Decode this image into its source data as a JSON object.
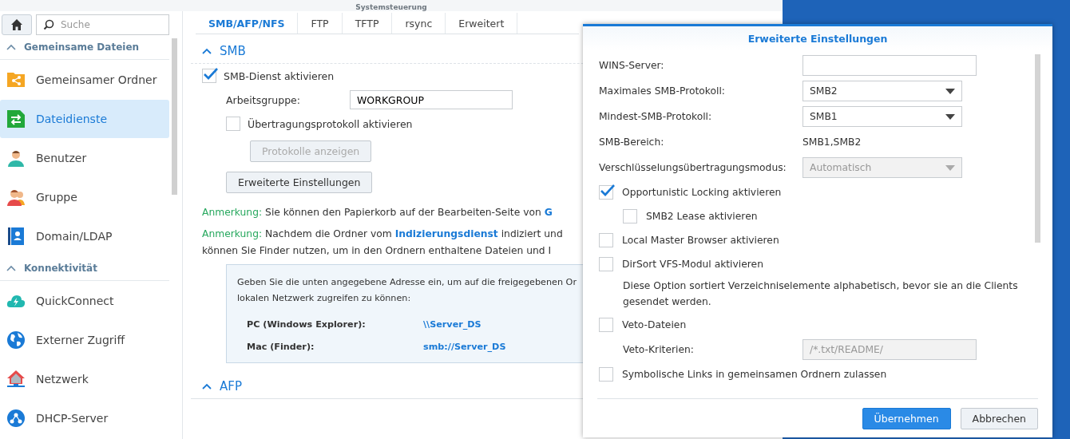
{
  "window": {
    "title": "Systemsteuerung"
  },
  "sidebar": {
    "search": {
      "placeholder": "Suche"
    },
    "sections": [
      {
        "title": "Gemeinsame Dateien",
        "expanded": true,
        "items": [
          {
            "label": "Gemeinsamer Ordner",
            "selected": false
          },
          {
            "label": "Dateidienste",
            "selected": true
          },
          {
            "label": "Benutzer",
            "selected": false
          },
          {
            "label": "Gruppe",
            "selected": false
          },
          {
            "label": "Domain/LDAP",
            "selected": false
          }
        ]
      },
      {
        "title": "Konnektivität",
        "expanded": true,
        "items": [
          {
            "label": "QuickConnect",
            "selected": false
          },
          {
            "label": "Externer Zugriff",
            "selected": false
          },
          {
            "label": "Netzwerk",
            "selected": false
          },
          {
            "label": "DHCP-Server",
            "selected": false
          }
        ]
      }
    ]
  },
  "tabs": [
    {
      "label": "SMB/AFP/NFS",
      "selected": true
    },
    {
      "label": "FTP",
      "selected": false
    },
    {
      "label": "TFTP",
      "selected": false
    },
    {
      "label": "rsync",
      "selected": false
    },
    {
      "label": "Erweitert",
      "selected": false
    }
  ],
  "smb": {
    "title": "SMB",
    "expanded": true,
    "enable": {
      "label": "SMB-Dienst aktivieren",
      "checked": true
    },
    "workgroup": {
      "label": "Arbeitsgruppe:",
      "value": "WORKGROUP"
    },
    "log": {
      "label": "Übertragungsprotokoll aktivieren",
      "checked": false
    },
    "log_button": {
      "label": "Protokolle anzeigen",
      "disabled": true
    },
    "advanced_button": {
      "label": "Erweiterte Einstellungen",
      "disabled": false
    },
    "notes": [
      {
        "label": "Anmerkung:",
        "lines": [
          [
            "Sie können den Papierkorb auf der Bearbeiten-Seite von ",
            "G"
          ]
        ]
      },
      {
        "label": "Anmerkung:",
        "lines": [
          [
            "Nachdem die Ordner vom ",
            "Indizierungsdienst",
            " indiziert und"
          ],
          [
            "können Sie Finder nutzen, um in den Ordnern enthaltene Dateien und I"
          ]
        ]
      }
    ],
    "info": {
      "lines": [
        "Geben Sie die unten angegebene Adresse ein, um auf die freigegebenen Or",
        "lokalen Netzwerk zugreifen zu können:"
      ],
      "rows": [
        {
          "label": "PC (Windows Explorer):",
          "value": "\\\\Server_DS"
        },
        {
          "label": "Mac (Finder):",
          "value": "smb://Server_DS"
        }
      ]
    }
  },
  "afp": {
    "title": "AFP",
    "expanded": true
  },
  "dialog": {
    "title": "Erweiterte Einstellungen",
    "rows": [
      {
        "kind": "field",
        "label": "WINS-Server:",
        "value": "",
        "disabled": false
      },
      {
        "kind": "select",
        "label": "Maximales SMB-Protokoll:",
        "value": "SMB2",
        "disabled": false
      },
      {
        "kind": "select",
        "label": "Mindest-SMB-Protokoll:",
        "value": "SMB1",
        "disabled": false
      },
      {
        "kind": "value",
        "label": "SMB-Bereich:",
        "value": "SMB1,SMB2"
      },
      {
        "kind": "select",
        "label": "Verschlüsselungsübertragungsmodus:",
        "value": "Automatisch",
        "disabled": true
      },
      {
        "kind": "checkbox",
        "label": "Opportunistic Locking aktivieren",
        "checked": true,
        "sub": false
      },
      {
        "kind": "checkbox",
        "label": "SMB2 Lease aktivieren",
        "checked": false,
        "sub": true
      },
      {
        "kind": "checkbox",
        "label": "Local Master Browser aktivieren",
        "checked": false,
        "sub": false
      },
      {
        "kind": "checkbox",
        "label": "DirSort VFS-Modul aktivieren",
        "checked": false,
        "sub": false
      },
      {
        "kind": "description",
        "text": "Diese Option sortiert Verzeichniselemente alphabetisch, bevor sie an die Clients gesendet werden."
      },
      {
        "kind": "checkbox",
        "label": "Veto-Dateien",
        "checked": false,
        "sub": false
      },
      {
        "kind": "field",
        "label": "Veto-Kriterien:",
        "value": "/*.txt/README/",
        "disabled": true,
        "sub": true
      },
      {
        "kind": "checkbox",
        "label": "Symbolische Links in gemeinsamen Ordnern zulassen",
        "checked": false,
        "sub": false
      }
    ],
    "buttons": [
      {
        "label": "Übernehmen",
        "primary": true
      },
      {
        "label": "Abbrechen",
        "primary": false
      }
    ]
  }
}
